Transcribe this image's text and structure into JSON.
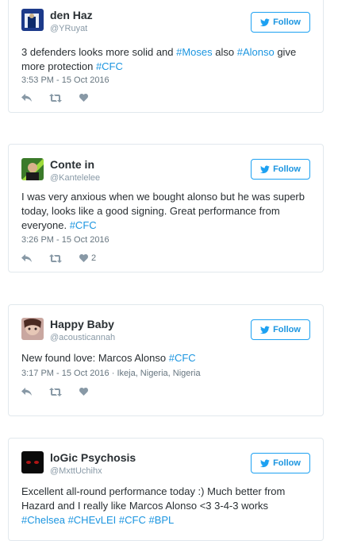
{
  "follow_label": "Follow",
  "accent_color": "#1da1f2",
  "tweets": [
    {
      "name": "den Haz",
      "handle": "@YRuyat",
      "text_segments": [
        {
          "t": "3 defenders looks more solid and ",
          "tag": false
        },
        {
          "t": "#Moses",
          "tag": true
        },
        {
          "t": " also ",
          "tag": false
        },
        {
          "t": "#Alonso",
          "tag": true
        },
        {
          "t": " give more protection ",
          "tag": false
        },
        {
          "t": "#CFC",
          "tag": true
        }
      ],
      "time": "3:53 PM - 15 Oct 2016",
      "location": "",
      "likes": ""
    },
    {
      "name": "Conte in",
      "handle": "@Kantelelee",
      "text_segments": [
        {
          "t": "I was very anxious when we bought alonso but he was superb today, looks like a good signing. Great performance from everyone. ",
          "tag": false
        },
        {
          "t": "#CFC",
          "tag": true
        }
      ],
      "time": "3:26 PM - 15 Oct 2016",
      "location": "",
      "likes": "2"
    },
    {
      "name": "Happy Baby",
      "handle": "@acousticannah",
      "text_segments": [
        {
          "t": "New found love: Marcos Alonso ",
          "tag": false
        },
        {
          "t": "#CFC",
          "tag": true
        }
      ],
      "time": "3:17 PM - 15 Oct 2016",
      "location": "Ikeja, Nigeria, Nigeria",
      "likes": ""
    },
    {
      "name": "loGic Psychosis",
      "handle": "@MxttUchihx",
      "text_segments": [
        {
          "t": "Excellent all-round performance today :) Much better from Hazard and I really like Marcos Alonso <3 3-4-3 works ",
          "tag": false
        },
        {
          "t": "#Chelsea",
          "tag": true
        },
        {
          "t": " ",
          "tag": false
        },
        {
          "t": "#CHEvLEI",
          "tag": true
        },
        {
          "t": " ",
          "tag": false
        },
        {
          "t": "#CFC",
          "tag": true
        },
        {
          "t": " ",
          "tag": false
        },
        {
          "t": "#BPL",
          "tag": true
        }
      ],
      "time": "",
      "location": "",
      "likes": ""
    }
  ]
}
